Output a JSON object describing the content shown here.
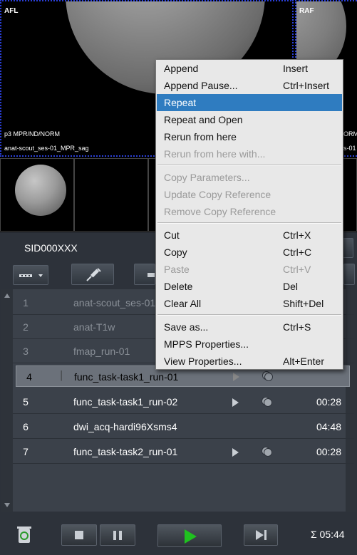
{
  "viewer": {
    "main_label": "AFL",
    "right_label": "RAF",
    "protocol_info": "p3 MPR/ND/NORM",
    "series_name": "anat-scout_ses-01_MPR_sag",
    "right_info_1": "ORM",
    "right_info_2": "s-01"
  },
  "panel": {
    "subject_id": "SID000XXX"
  },
  "queue": {
    "rows": [
      {
        "num": "1",
        "name": "anat-scout_ses-01",
        "duration": ""
      },
      {
        "num": "2",
        "name": "anat-T1w",
        "duration": ""
      },
      {
        "num": "3",
        "name": "fmap_run-01",
        "duration": ""
      },
      {
        "num": "4",
        "name": "func_task-task1_run-01",
        "duration": ""
      },
      {
        "num": "5",
        "name": "func_task-task1_run-02",
        "duration": "00:28"
      },
      {
        "num": "6",
        "name": "dwi_acq-hardi96Xsms4",
        "duration": "04:48"
      },
      {
        "num": "7",
        "name": "func_task-task2_run-01",
        "duration": "00:28"
      }
    ]
  },
  "footer": {
    "total_time": "Σ 05:44"
  },
  "context_menu": {
    "items": [
      {
        "label": "Append",
        "shortcut": "Insert"
      },
      {
        "label": "Append Pause...",
        "shortcut": "Ctrl+Insert"
      },
      {
        "label": "Repeat",
        "shortcut": ""
      },
      {
        "label": "Repeat and Open",
        "shortcut": ""
      },
      {
        "label": "Rerun from here",
        "shortcut": ""
      },
      {
        "label": "Rerun from here with...",
        "shortcut": ""
      },
      {
        "label": "Copy Parameters...",
        "shortcut": ""
      },
      {
        "label": "Update Copy Reference",
        "shortcut": ""
      },
      {
        "label": "Remove Copy Reference",
        "shortcut": ""
      },
      {
        "label": "Cut",
        "shortcut": "Ctrl+X"
      },
      {
        "label": "Copy",
        "shortcut": "Ctrl+C"
      },
      {
        "label": "Paste",
        "shortcut": "Ctrl+V"
      },
      {
        "label": "Delete",
        "shortcut": "Del"
      },
      {
        "label": "Clear All",
        "shortcut": "Shift+Del"
      },
      {
        "label": "Save as...",
        "shortcut": "Ctrl+S"
      },
      {
        "label": "MPPS Properties...",
        "shortcut": ""
      },
      {
        "label": "View Properties...",
        "shortcut": "Alt+Enter"
      }
    ]
  },
  "colors": {
    "menu_highlight": "#2f7cc0",
    "viewport_border": "#2a3fd8",
    "play_green": "#1fc21f"
  }
}
